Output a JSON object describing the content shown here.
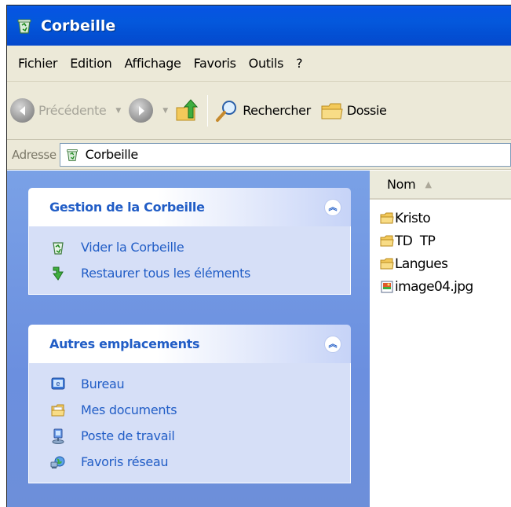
{
  "window": {
    "title": "Corbeille"
  },
  "menubar": {
    "items": [
      "Fichier",
      "Edition",
      "Affichage",
      "Favoris",
      "Outils",
      "?"
    ]
  },
  "toolbar": {
    "back_label": "Précédente",
    "search_label": "Rechercher",
    "folders_label": "Dossie"
  },
  "address": {
    "label": "Adresse",
    "value": "Corbeille"
  },
  "taskpane": {
    "groups": [
      {
        "title": "Gestion de la Corbeille",
        "items": [
          {
            "label": "Vider la Corbeille",
            "icon": "empty-recycle-bin-icon"
          },
          {
            "label": "Restaurer tous les éléments",
            "icon": "restore-icon"
          }
        ]
      },
      {
        "title": "Autres emplacements",
        "items": [
          {
            "label": "Bureau",
            "icon": "desktop-icon"
          },
          {
            "label": "Mes documents",
            "icon": "my-documents-icon"
          },
          {
            "label": "Poste de travail",
            "icon": "my-computer-icon"
          },
          {
            "label": "Favoris réseau",
            "icon": "network-places-icon"
          }
        ]
      }
    ]
  },
  "filelist": {
    "column_header": "Nom",
    "files": [
      {
        "name": "Kristo",
        "type": "folder"
      },
      {
        "name": "TD  TP",
        "type": "folder"
      },
      {
        "name": "Langues",
        "type": "folder"
      },
      {
        "name": "image04.jpg",
        "type": "image"
      }
    ]
  },
  "colors": {
    "titlebar": "#0458dc",
    "taskpane_bg": "#7aa1e6",
    "task_link": "#215dc6",
    "chrome_bg": "#ece9d8"
  }
}
